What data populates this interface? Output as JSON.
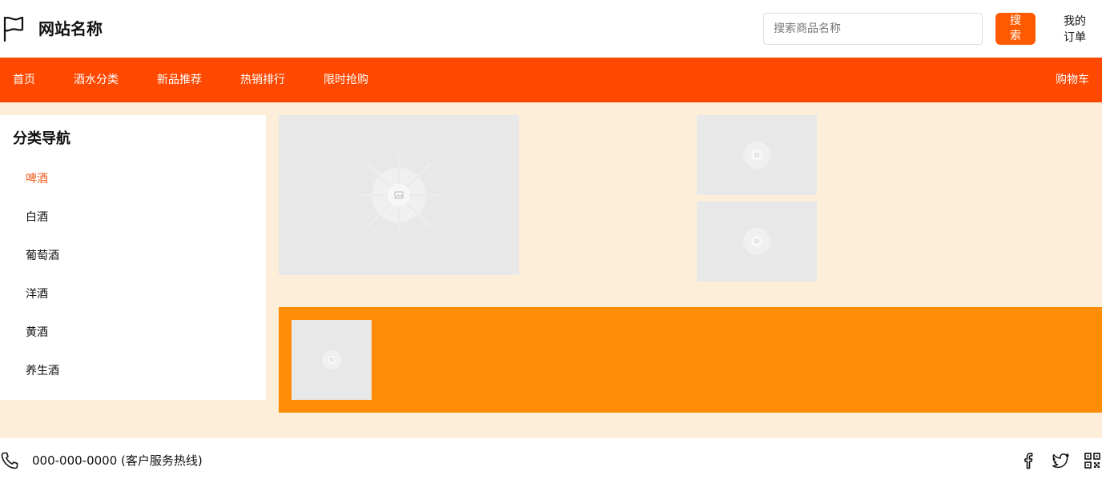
{
  "header": {
    "site_name": "网站名称",
    "search_placeholder": "搜索商品名称",
    "search_value": "",
    "search_button": "搜索",
    "my_orders": "我的订单"
  },
  "nav": {
    "items": [
      {
        "label": "首页"
      },
      {
        "label": "酒水分类"
      },
      {
        "label": "新品推荐"
      },
      {
        "label": "热销排行"
      },
      {
        "label": "限时抢购"
      }
    ],
    "cart": "购物车"
  },
  "sidebar": {
    "title": "分类导航",
    "items": [
      {
        "label": "啤酒",
        "active": true
      },
      {
        "label": "白酒"
      },
      {
        "label": "葡萄酒"
      },
      {
        "label": "洋酒"
      },
      {
        "label": "黄酒"
      },
      {
        "label": "养生酒"
      }
    ]
  },
  "footer": {
    "hotline": "000-000-0000 (客户服务热线)"
  },
  "colors": {
    "nav_bg": "#ff4800",
    "accent": "#ff5a00",
    "active_item": "#f25a1a",
    "main_bg": "#fdeeda",
    "promo_bg": "#ff8c05",
    "placeholder_bg": "#e8e8e8"
  },
  "icons": [
    "flag-icon",
    "phone-icon",
    "facebook-icon",
    "twitter-icon",
    "qr-code-icon",
    "image-placeholder-icon"
  ]
}
